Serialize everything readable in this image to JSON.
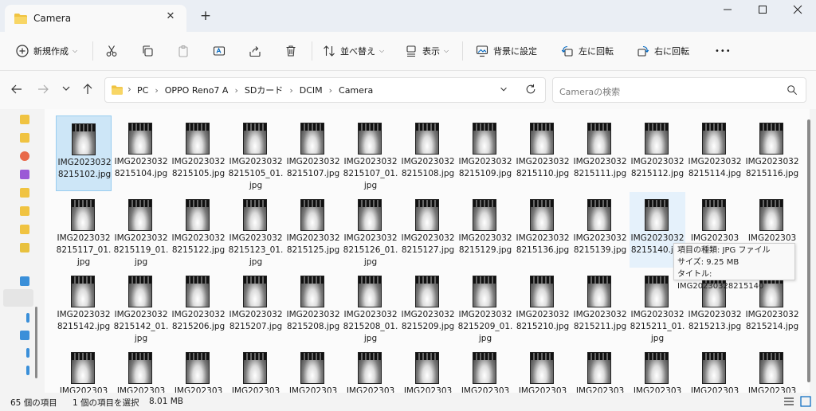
{
  "window": {
    "tab_title": "Camera",
    "tab_close": "✕",
    "new_tab": "+"
  },
  "toolbar": {
    "new_label": "新規作成",
    "sort_label": "並べ替え",
    "view_label": "表示",
    "set_background_label": "背景に設定",
    "rotate_left_label": "左に回転",
    "rotate_right_label": "右に回転",
    "more": "•••"
  },
  "address": {
    "crumbs": [
      "PC",
      "OPPO Reno7 A",
      "SDカード",
      "DCIM",
      "Camera"
    ],
    "separator": "›"
  },
  "search": {
    "placeholder": "Cameraの検索"
  },
  "files": [
    "IMG20230328215102.jpg",
    "IMG20230328215104.jpg",
    "IMG20230328215105.jpg",
    "IMG20230328215105_01.jpg",
    "IMG20230328215107.jpg",
    "IMG20230328215107_01.jpg",
    "IMG20230328215108.jpg",
    "IMG20230328215109.jpg",
    "IMG20230328215110.jpg",
    "IMG20230328215111.jpg",
    "IMG20230328215112.jpg",
    "IMG20230328215114.jpg",
    "IMG20230328215116.jpg",
    "IMG20230328215117_01.jpg",
    "IMG20230328215119_01.jpg",
    "IMG20230328215122.jpg",
    "IMG20230328215123_01.jpg",
    "IMG20230328215125.jpg",
    "IMG20230328215126_01.jpg",
    "IMG20230328215127.jpg",
    "IMG20230328215129.jpg",
    "IMG20230328215136.jpg",
    "IMG20230328215139.jpg",
    "IMG20230328215140.jpg",
    "IMG202303",
    "IMG202303",
    "IMG20230328215142.jpg",
    "IMG20230328215142_01.jpg",
    "IMG20230328215206.jpg",
    "IMG20230328215207.jpg",
    "IMG20230328215208.jpg",
    "IMG20230328215208_01.jpg",
    "IMG20230328215209.jpg",
    "IMG20230328215209_01.jpg",
    "IMG20230328215210.jpg",
    "IMG20230328215211.jpg",
    "IMG20230328215211_01.jpg",
    "IMG20230328215213.jpg",
    "IMG20230328215214.jpg",
    "IMG202303",
    "IMG202303",
    "IMG202303",
    "IMG202303",
    "IMG202303",
    "IMG202303",
    "IMG202303",
    "IMG202303",
    "IMG202303",
    "IMG202303",
    "IMG202303",
    "IMG202303",
    "IMG202303"
  ],
  "tooltip": {
    "type": "項目の種類: JPG ファイル",
    "size": "サイズ: 9.25 MB",
    "title": "タイトル: IMG20230328215140"
  },
  "status": {
    "count": "65 個の項目",
    "selection": "1 個の項目を選択",
    "selection_size": "8.01 MB"
  },
  "colors": {
    "accent": "#0067c0",
    "selected_bg": "#cde6f7",
    "folder": "#f0c341"
  }
}
